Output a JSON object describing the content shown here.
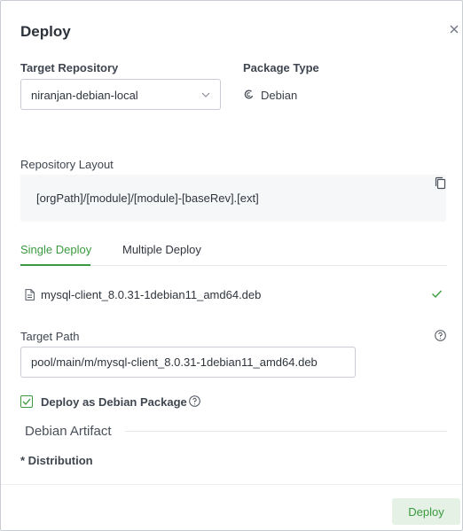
{
  "dialog": {
    "title": "Deploy"
  },
  "target_repository": {
    "label": "Target Repository",
    "value": "niranjan-debian-local"
  },
  "package_type": {
    "label": "Package Type",
    "value": "Debian"
  },
  "repository_layout": {
    "label": "Repository Layout",
    "value": "[orgPath]/[module]/[module]-[baseRev].[ext]"
  },
  "tabs": [
    {
      "label": "Single Deploy",
      "active": true
    },
    {
      "label": "Multiple Deploy",
      "active": false
    }
  ],
  "file": {
    "name": "mysql-client_8.0.31-1debian11_amd64.deb",
    "status": "uploaded"
  },
  "target_path": {
    "label": "Target Path",
    "value": "pool/main/m/mysql-client_8.0.31-1debian11_amd64.deb"
  },
  "deploy_as_debian": {
    "label": "Deploy as Debian Package",
    "checked": true
  },
  "debian_artifact": {
    "section_label": "Debian Artifact",
    "distribution_label": "* Distribution"
  },
  "footer": {
    "deploy_label": "Deploy"
  },
  "colors": {
    "accent": "#3a9a3f",
    "accent_light": "#e6f1e6",
    "border": "#c9cdd3",
    "text": "#2f353d"
  },
  "icons": {
    "close": "close-icon",
    "chevron": "chevron-down-icon",
    "package": "debian-icon",
    "copy": "copy-icon",
    "file": "file-icon",
    "check": "check-icon",
    "help": "help-icon"
  }
}
